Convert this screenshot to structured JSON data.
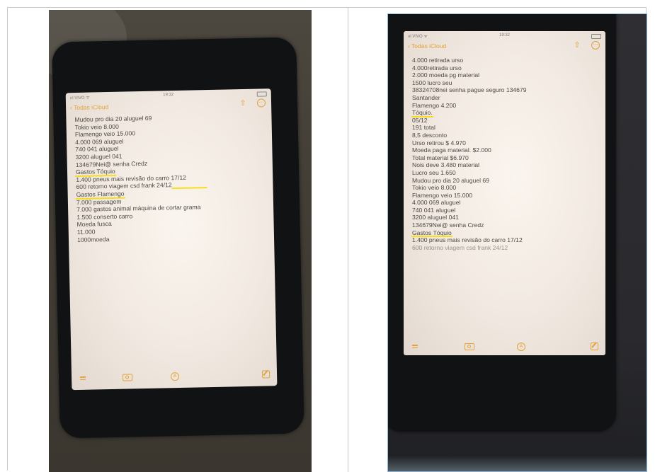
{
  "left_phone": {
    "status": {
      "carrier": "ııl VIVO ᯤ",
      "time": "19:32"
    },
    "nav": {
      "back_label": "Todas iCloud"
    },
    "notes": [
      {
        "text": "Mudou pro dia 20 aluguel 69"
      },
      {
        "text": "Tokio veio 8.000"
      },
      {
        "text": "Flamengo veio 15.000"
      },
      {
        "text": "4.000 069 aluguel"
      },
      {
        "text": "740 041 aluguel"
      },
      {
        "text": "3200 aluguel 041"
      },
      {
        "text": "134679Nei@ senha Credz"
      },
      {
        "text": "Gastos Tóquio",
        "highlight": true
      },
      {
        "text": "1.400 pneus mais revisão do carro 17/12"
      },
      {
        "text": "600 retorno viagem csd frank 24/12",
        "highlight_part": "frank 24/12"
      },
      {
        "text": "Gastos Flamengo",
        "highlight": true
      },
      {
        "text": "7.000 passagem"
      },
      {
        "text": "7.000 gastos animal máquina de cortar grama"
      },
      {
        "text": "1.500 conserto carro"
      },
      {
        "text": "Moeda fusca"
      },
      {
        "text": "11.000"
      },
      {
        "text": "1000moeda"
      }
    ]
  },
  "right_phone": {
    "status": {
      "carrier": "ııl VIVO ᯤ",
      "time": "19:32"
    },
    "nav": {
      "back_label": "Todas iCloud"
    },
    "notes": [
      {
        "text": "4.000 retirada urso"
      },
      {
        "text": "4.000retirada urso"
      },
      {
        "text": "2.000 moeda pg material"
      },
      {
        "text": "1500 lucro seu"
      },
      {
        "text": "38324708nei senha pague seguro 134679"
      },
      {
        "text": "Santander"
      },
      {
        "text": "Flamengo 4.200"
      },
      {
        "text": "Tóquio.",
        "highlight": true
      },
      {
        "text": "05/12"
      },
      {
        "text": "191 total"
      },
      {
        "text": "8,5 desconto"
      },
      {
        "text": "Urso retirou $ 4.970"
      },
      {
        "text": "Moeda paga material. $2.000"
      },
      {
        "text": "Total material $6.970"
      },
      {
        "text": "Nois deve 3.480 material"
      },
      {
        "text": "Lucro seu 1.650"
      },
      {
        "text": "Mudou pro dia 20 aluguel 69"
      },
      {
        "text": "Tokio veio 8.000"
      },
      {
        "text": "Flamengo veio 15.000"
      },
      {
        "text": "4.000 069 aluguel"
      },
      {
        "text": "740 041 aluguel"
      },
      {
        "text": "3200 aluguel 041"
      },
      {
        "text": "134679Nei@ senha Credz"
      },
      {
        "text": "Gastos Tóquio",
        "highlight": true
      },
      {
        "text": "1.400 pneus mais revisão do carro 17/12"
      },
      {
        "text": "600 retorno viagem csd frank 24/12"
      }
    ]
  },
  "colors": {
    "accent": "#e3a23a",
    "highlight": "#f6dd1e",
    "note_text": "#4d4946"
  }
}
